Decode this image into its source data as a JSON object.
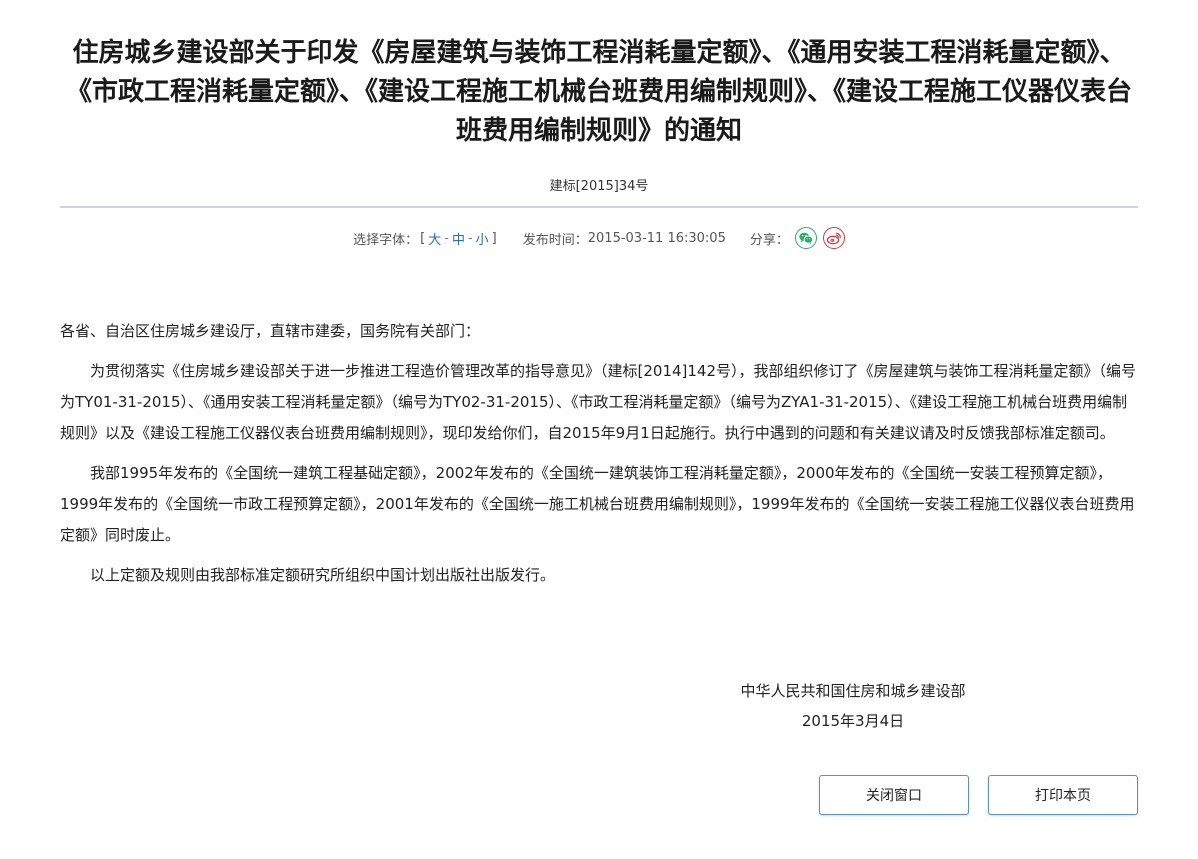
{
  "article": {
    "title": "住房城乡建设部关于印发《房屋建筑与装饰工程消耗量定额》、《通用安装工程消耗量定额》、《市政工程消耗量定额》、《建设工程施工机械台班费用编制规则》、《建设工程施工仪器仪表台班费用编制规则》的通知",
    "doc_number": "建标[2015]34号"
  },
  "meta": {
    "font_select_label": "选择字体：",
    "bracket_open": "[",
    "bracket_close": "]",
    "font_sizes": [
      "大",
      "中",
      "小"
    ],
    "separator": "-",
    "publish_label": "发布时间：",
    "publish_time": "2015-03-11 16:30:05",
    "share_label": "分享：",
    "share_icons": [
      "wechat-icon",
      "weibo-icon"
    ],
    "colors": {
      "link": "#1f6fc1",
      "wechat": "#2aae67",
      "weibo": "#d9363e"
    }
  },
  "body": {
    "salutation": "各省、自治区住房城乡建设厅，直辖市建委，国务院有关部门：",
    "paragraphs": [
      "为贯彻落实《住房城乡建设部关于进一步推进工程造价管理改革的指导意见》（建标[2014]142号），我部组织修订了《房屋建筑与装饰工程消耗量定额》（编号为TY01-31-2015）、《通用安装工程消耗量定额》（编号为TY02-31-2015）、《市政工程消耗量定额》（编号为ZYA1-31-2015）、《建设工程施工机械台班费用编制规则》以及《建设工程施工仪器仪表台班费用编制规则》，现印发给你们，自2015年9月1日起施行。执行中遇到的问题和有关建议请及时反馈我部标准定额司。",
      "我部1995年发布的《全国统一建筑工程基础定额》，2002年发布的《全国统一建筑装饰工程消耗量定额》，2000年发布的《全国统一安装工程预算定额》，1999年发布的《全国统一市政工程预算定额》，2001年发布的《全国统一施工机械台班费用编制规则》，1999年发布的《全国统一安装工程施工仪器仪表台班费用定额》同时废止。",
      "以上定额及规则由我部标准定额研究所组织中国计划出版社出版发行。"
    ]
  },
  "signature": {
    "org": "中华人民共和国住房和城乡建设部",
    "date": "2015年3月4日"
  },
  "buttons": {
    "close_label": "关闭窗口",
    "print_label": "打印本页"
  }
}
